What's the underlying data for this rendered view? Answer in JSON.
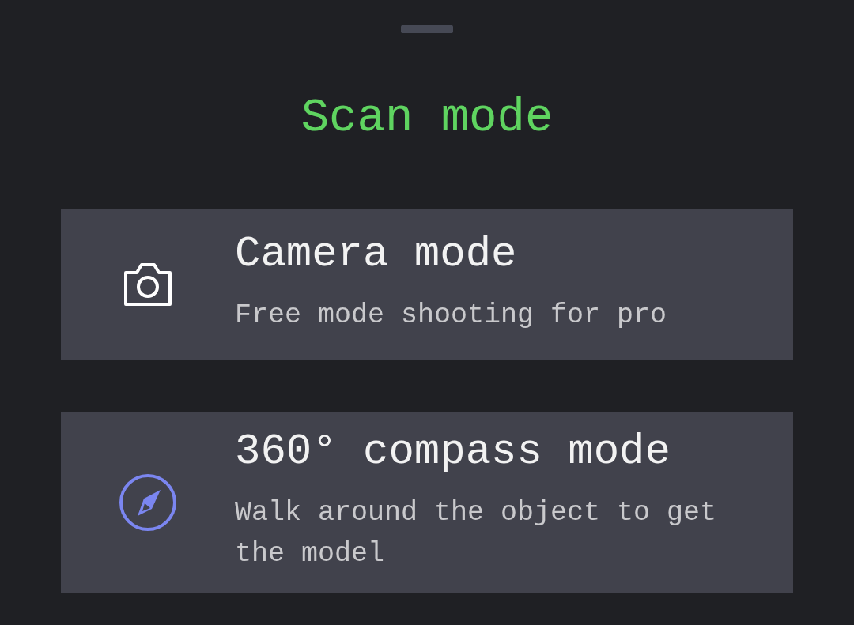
{
  "title": "Scan mode",
  "modes": [
    {
      "kind": "camera",
      "color": "#ffffff",
      "name": "Camera mode",
      "description": "Free mode shooting for pro"
    },
    {
      "kind": "compass",
      "color": "#7b86f0",
      "name": "360° compass mode",
      "description": "Walk around the object to get the model"
    }
  ]
}
